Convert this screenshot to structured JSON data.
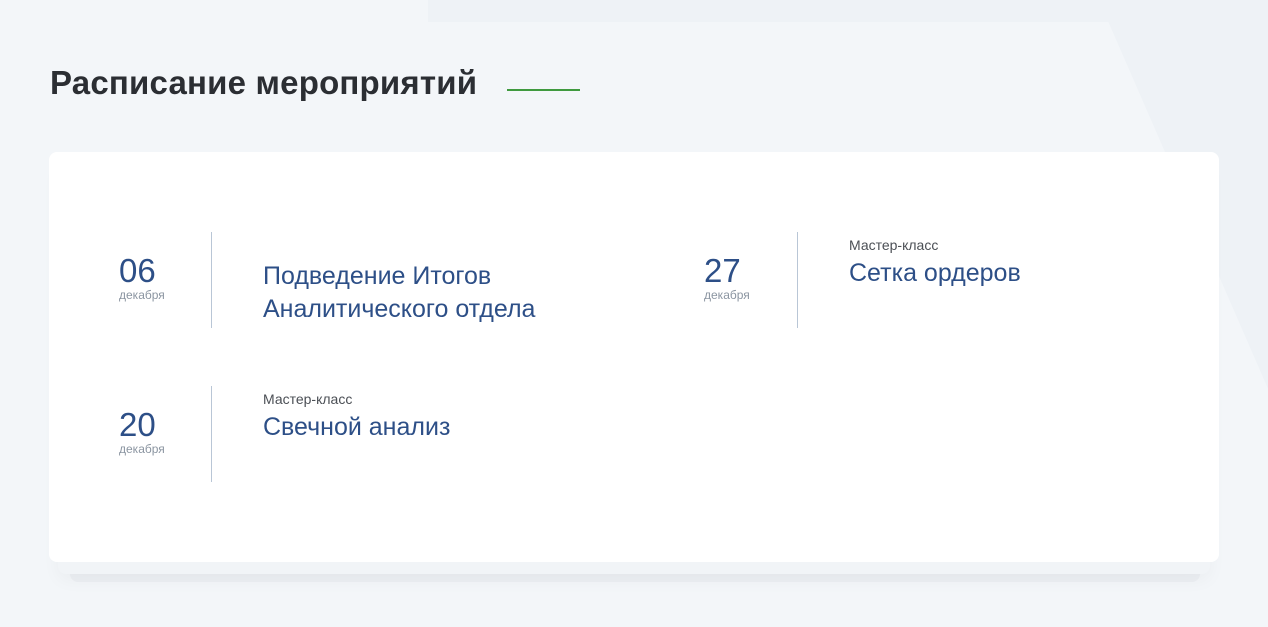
{
  "page": {
    "title": "Расписание мероприятий"
  },
  "events": [
    {
      "day": "06",
      "month": "декабря",
      "type": "",
      "title": "Подведение Итогов Аналитического отдела"
    },
    {
      "day": "27",
      "month": "декабря",
      "type": "Мастер-класс",
      "title": "Сетка ордеров"
    },
    {
      "day": "20",
      "month": "декабря",
      "type": "Мастер-класс",
      "title": "Свечной анализ"
    }
  ],
  "colors": {
    "accent": "#3f9a3f",
    "date_blue": "#2d4f87",
    "title_dark": "#2b2e33",
    "background": "#f3f6f9"
  }
}
